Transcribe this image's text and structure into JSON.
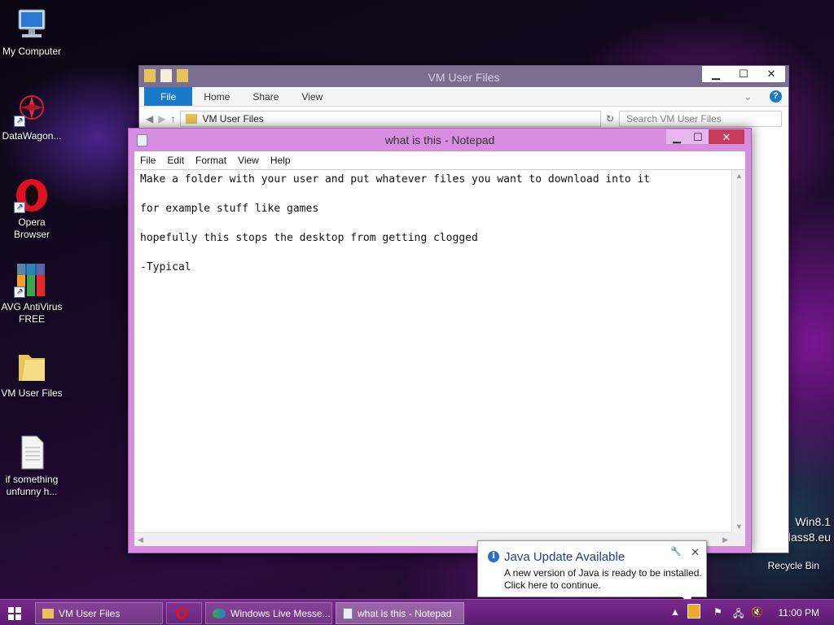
{
  "desktop": {
    "icons": [
      {
        "label": "My Computer"
      },
      {
        "label": "DataWagon..."
      },
      {
        "label": "Opera Browser"
      },
      {
        "label": "AVG AntiVirus FREE"
      },
      {
        "label": "VM User Files"
      },
      {
        "label": "if something unfunny h..."
      }
    ],
    "recycle_bin": "Recycle Bin",
    "watermark_line1": "Win8.1",
    "watermark_line2": "lass8.eu"
  },
  "explorer": {
    "title": "VM User Files",
    "tabs": [
      "File",
      "Home",
      "Share",
      "View"
    ],
    "breadcrumb": "VM User Files",
    "search_placeholder": "Search VM User Files"
  },
  "notepad": {
    "title": "what is this - Notepad",
    "menu": [
      "File",
      "Edit",
      "Format",
      "View",
      "Help"
    ],
    "lines": [
      "Make a folder with your user and put whatever files you want to download into it",
      "for example stuff like games",
      "hopefully this stops the desktop from getting clogged",
      "-Typical"
    ]
  },
  "notification": {
    "title": "Java Update Available",
    "line1": "A new version of Java is ready to be installed.",
    "line2": "Click here to continue."
  },
  "taskbar": {
    "items": [
      {
        "label": "VM User Files"
      },
      {
        "label": ""
      },
      {
        "label": "Windows Live Messe..."
      },
      {
        "label": "what is this - Notepad"
      }
    ],
    "clock": "11:00 PM"
  },
  "colors": {
    "accent": "#1979ca",
    "taskbar": "#6a2280",
    "notepad_frame": "#d88ee0"
  }
}
